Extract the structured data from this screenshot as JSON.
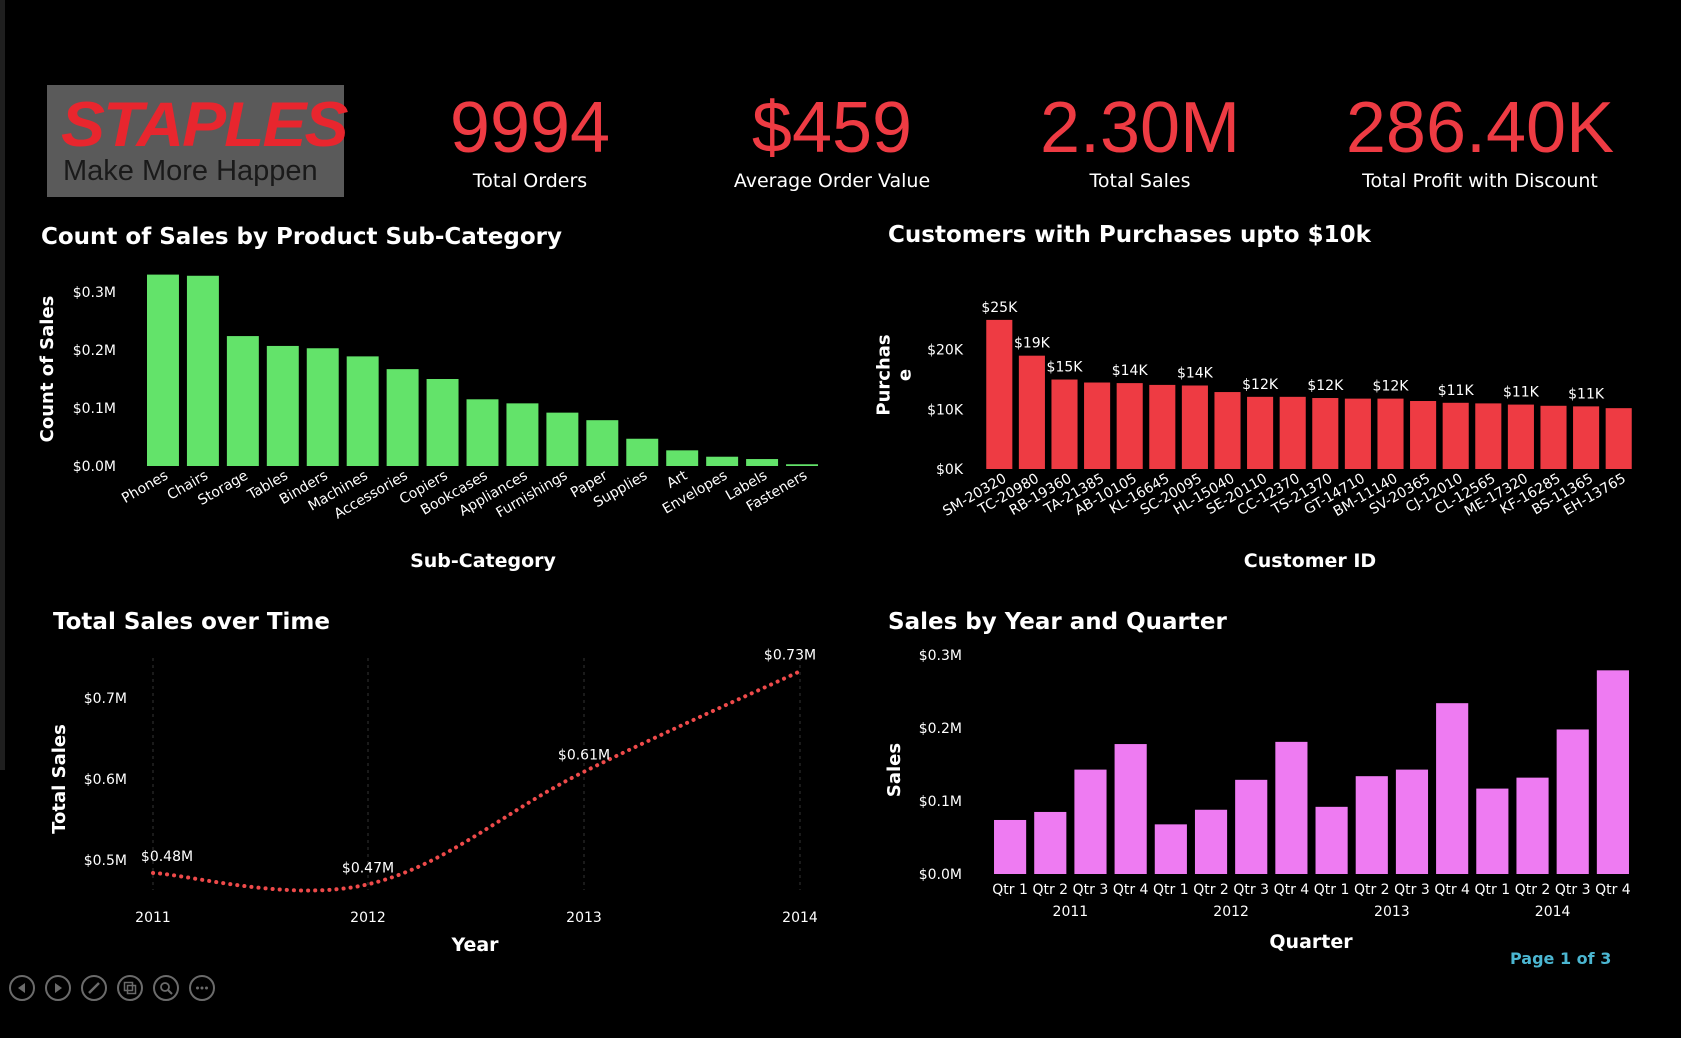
{
  "brand": {
    "name": "STAPLES",
    "tagline": "Make More Happen"
  },
  "kpis": [
    {
      "value": "9994",
      "label": "Total Orders"
    },
    {
      "value": "$459",
      "label": "Average Order Value"
    },
    {
      "value": "2.30M",
      "label": "Total Sales"
    },
    {
      "value": "286.40K",
      "label": "Total Profit with Discount"
    }
  ],
  "colors": {
    "kpi": "#ee3b43",
    "green": "#63e36a",
    "red": "#ee3b43",
    "line": "#ee4a4a",
    "violet": "#ee7bf2",
    "page_indicator": "#4bb6d1"
  },
  "page_indicator": "Page 1 of 3",
  "nav_icons": [
    "back-icon",
    "forward-icon",
    "pen-icon",
    "screens-icon",
    "zoom-icon",
    "more-icon"
  ],
  "chart_data": [
    {
      "type": "bar",
      "title": "Count of Sales by Product Sub-Category",
      "xlabel": "Sub-Category",
      "ylabel": "Count of Sales",
      "categories": [
        "Phones",
        "Chairs",
        "Storage",
        "Tables",
        "Binders",
        "Machines",
        "Accessories",
        "Copiers",
        "Bookcases",
        "Appliances",
        "Furnishings",
        "Paper",
        "Supplies",
        "Art",
        "Envelopes",
        "Labels",
        "Fasteners"
      ],
      "values": [
        0.33,
        0.328,
        0.224,
        0.207,
        0.203,
        0.189,
        0.167,
        0.15,
        0.115,
        0.108,
        0.092,
        0.079,
        0.047,
        0.027,
        0.016,
        0.012,
        0.003
      ],
      "yticks": [
        "$0.0M",
        "$0.1M",
        "$0.2M",
        "$0.3M"
      ],
      "ylim": [
        0,
        0.35
      ],
      "color": "#63e36a"
    },
    {
      "type": "bar",
      "title": "Customers with Purchases upto $10k",
      "xlabel": "Customer ID",
      "ylabel": "Purchase",
      "categories": [
        "SM-20320",
        "TC-20980",
        "RB-19360",
        "TA-21385",
        "AB-10105",
        "KL-16645",
        "SC-20095",
        "HL-15040",
        "SE-20110",
        "CC-12370",
        "TS-21370",
        "GT-14710",
        "BM-11140",
        "SV-20365",
        "CJ-12010",
        "CL-12565",
        "ME-17320",
        "KF-16285",
        "BS-11365",
        "EH-13765"
      ],
      "values": [
        25,
        19,
        15,
        14.5,
        14.4,
        14.1,
        14,
        12.9,
        12.1,
        12.1,
        11.9,
        11.8,
        11.8,
        11.4,
        11.1,
        11,
        10.8,
        10.6,
        10.5,
        10.2
      ],
      "data_labels": [
        "$25K",
        "$19K",
        "$15K",
        "",
        "$14K",
        "",
        "$14K",
        "",
        "$12K",
        "",
        "$12K",
        "",
        "$12K",
        "",
        "$11K",
        "",
        "$11K",
        "",
        "$11K",
        ""
      ],
      "yticks": [
        "$0K",
        "$10K",
        "$20K"
      ],
      "ylim": [
        0,
        28
      ],
      "color": "#ee3b43"
    },
    {
      "type": "line",
      "title": "Total Sales over Time",
      "xlabel": "Year",
      "ylabel": "Total Sales",
      "x": [
        "2011",
        "2012",
        "2013",
        "2014"
      ],
      "values": [
        0.484,
        0.47,
        0.609,
        0.733
      ],
      "data_labels": [
        "$0.48M",
        "$0.47M",
        "$0.61M",
        "$0.73M"
      ],
      "yticks": [
        "$0.5M",
        "$0.6M",
        "$0.7M"
      ],
      "ylim": [
        0.4,
        0.76
      ],
      "color": "#ee4a4a"
    },
    {
      "type": "bar",
      "title": "Sales by Year and Quarter",
      "xlabel": "Quarter",
      "ylabel": "Sales",
      "categories": [
        "Qtr 1",
        "Qtr 2",
        "Qtr 3",
        "Qtr 4",
        "Qtr 1",
        "Qtr 2",
        "Qtr 3",
        "Qtr 4",
        "Qtr 1",
        "Qtr 2",
        "Qtr 3",
        "Qtr 4",
        "Qtr 1",
        "Qtr 2",
        "Qtr 3",
        "Qtr 4"
      ],
      "groups": [
        "2011",
        "2012",
        "2013",
        "2014"
      ],
      "values": [
        0.074,
        0.085,
        0.143,
        0.178,
        0.068,
        0.088,
        0.129,
        0.181,
        0.092,
        0.134,
        0.143,
        0.234,
        0.117,
        0.132,
        0.198,
        0.279
      ],
      "yticks": [
        "$0.0M",
        "$0.1M",
        "$0.2M",
        "$0.3M"
      ],
      "ylim": [
        0,
        0.3
      ],
      "color": "#ee7bf2"
    }
  ]
}
